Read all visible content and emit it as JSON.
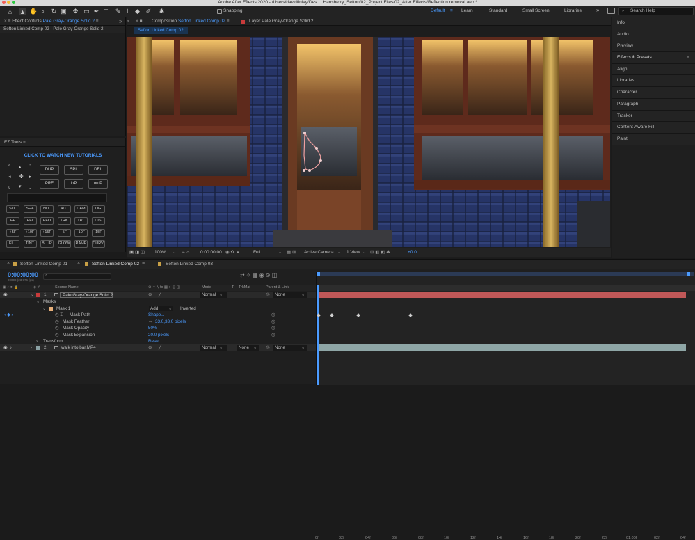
{
  "title_bar": {
    "title": "Adobe After Effects 2020 - /Users/davidfinlay/Des ... Hansberry_Sefton/02_Project Files/02_After Effects/Reflection removal.aep *"
  },
  "toolbar": {
    "snapping_label": "Snapping",
    "workspaces": [
      "Default",
      "Learn",
      "Standard",
      "Small Screen",
      "Libraries"
    ],
    "active_workspace": "Default",
    "search_placeholder": "Search Help"
  },
  "effect_controls": {
    "tab_label": "Effect Controls",
    "tab_layer": "Pale Gray-Orange Solid 2",
    "breadcrumb": "Sefton Linked Comp 02 · Pale Gray-Orange Solid 2"
  },
  "composition_panel": {
    "tab_label": "Composition",
    "tab_comp": "Sefton Linked Comp 02",
    "layer_tab": "Layer Pale Gray-Orange Solid 2",
    "sub_tab": "Sefton Linked Comp 02",
    "footer": {
      "zoom": "100%",
      "timecode": "0:00:00:00",
      "resolution": "Full",
      "camera": "Active Camera",
      "views": "1 View",
      "exposure": "+0.0"
    }
  },
  "ez_tools": {
    "title": "EZ Tools",
    "tutorial_link": "CLICK TO WATCH NEW TUTORIALS",
    "grid_buttons": [
      "DUP",
      "SPL",
      "DEL",
      "PRE",
      "inP",
      "outP"
    ],
    "small_buttons": [
      [
        "SOL",
        "SHA",
        "NUL",
        "ADJ",
        "CAM",
        "LIG"
      ],
      [
        "EE",
        "EEI",
        "EEO",
        "TRK",
        "TRL",
        "DIS"
      ],
      [
        "+5F",
        "+10F",
        "+15F",
        "-5F",
        "-10F",
        "-15F"
      ],
      [
        "FILL",
        "TINT",
        "BLUR",
        "GLOW",
        "RAMP",
        "CURV"
      ]
    ]
  },
  "right_panels": [
    "Info",
    "Audio",
    "Preview",
    "Effects & Presets",
    "Align",
    "Libraries",
    "Character",
    "Paragraph",
    "Tracker",
    "Content-Aware Fill",
    "Paint"
  ],
  "timeline": {
    "tabs": [
      "Sefton Linked Comp 01",
      "Sefton Linked Comp 02",
      "Sefton Linked Comp 03"
    ],
    "active_tab": "Sefton Linked Comp 02",
    "timecode": "0:00:00:00",
    "timecode_sub": "00000 (23.976 fps)",
    "search_placeholder": "",
    "columns": {
      "source_name": "Source Name",
      "mode": "Mode",
      "t": "T",
      "trkmat": "TrkMat",
      "parent": "Parent & Link"
    },
    "ruler_labels": [
      "0f",
      "02f",
      "04f",
      "06f",
      "08f",
      "10f",
      "12f",
      "14f",
      "16f",
      "18f",
      "20f",
      "22f",
      "01:00f",
      "02f",
      "04f"
    ],
    "layers": [
      {
        "number": "1",
        "name": "Pale Gray-Orange Solid 2",
        "mode": "Normal",
        "parent": "None",
        "color": "#c83b3b"
      },
      {
        "number": "2",
        "name": "walk into bar.MP4",
        "mode": "Normal",
        "trkmat": "None",
        "parent": "None",
        "color": "#8aa0a3"
      }
    ],
    "masks_label": "Masks",
    "mask_name": "Mask 1",
    "mask_mode": "Add",
    "mask_inverted": "Inverted",
    "properties": [
      {
        "name": "Mask Path",
        "value": "Shape..."
      },
      {
        "name": "Mask Feather",
        "value": "33.0,33.0 pixels"
      },
      {
        "name": "Mask Opacity",
        "value": "50%"
      },
      {
        "name": "Mask Expansion",
        "value": "20.0 pixels"
      }
    ],
    "transform_label": "Transform",
    "transform_value": "Reset"
  }
}
